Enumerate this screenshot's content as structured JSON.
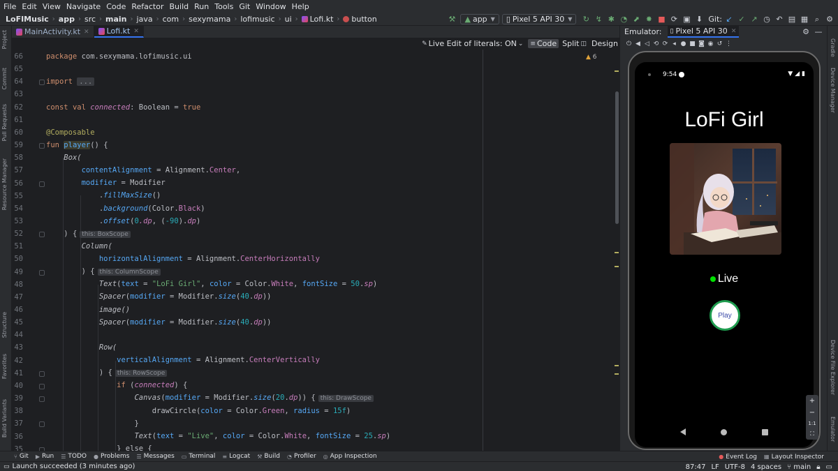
{
  "menu": [
    "File",
    "Edit",
    "View",
    "Navigate",
    "Code",
    "Refactor",
    "Build",
    "Run",
    "Tools",
    "Git",
    "Window",
    "Help"
  ],
  "breadcrumbs": [
    "LoFIMusic",
    "app",
    "src",
    "main",
    "java",
    "com",
    "sexymama",
    "lofimusic",
    "ui",
    "Lofi.kt",
    "button"
  ],
  "run_config": "app",
  "device": "Pixel 5 API 30",
  "git_label": "Git:",
  "tabs": [
    {
      "label": "MainActivity.kt",
      "active": false
    },
    {
      "label": "Lofi.kt",
      "active": true
    }
  ],
  "editor_toolbar": {
    "live_edit": "Live Edit of literals: ON",
    "code": "Code",
    "split": "Split",
    "design": "Design"
  },
  "warnings_count": "6",
  "code": {
    "line_numbers": [
      "66",
      "65",
      "64",
      "63",
      "62",
      "61",
      "60",
      "59",
      "58",
      "57",
      "56",
      "55",
      "54",
      "53",
      "52",
      "51",
      "50",
      "49",
      "48",
      "47",
      "46",
      "45",
      "44",
      "43",
      "42",
      "41",
      "40",
      "39",
      "38",
      "37",
      "36",
      "35"
    ],
    "l66": {
      "kw": "package",
      "rest": "com.sexymama.lofimusic.ui"
    },
    "l64": {
      "kw": "import",
      "fold": "..."
    },
    "l62": {
      "kw1": "const",
      "kw2": "val",
      "prop": "connected",
      "type": ": Boolean =",
      "val": "true"
    },
    "l60": {
      "ann": "@Composable"
    },
    "l59": {
      "kw": "fun",
      "name": "player",
      "rest": "() {"
    },
    "l58": {
      "text": "Box("
    },
    "l57": {
      "prop": "contentAlignment",
      "eq": "= Alignment.",
      "val": "Center",
      "end": ","
    },
    "l56": {
      "prop": "modifier",
      "rest": "= Modifier"
    },
    "l55": {
      "dot": ".",
      "fn": "fillMaxSize",
      "rest": "()"
    },
    "l54": {
      "dot": ".",
      "fn": "background",
      "open": "(Color.",
      "val": "Black",
      "close": ")"
    },
    "l53": {
      "dot": ".",
      "fn": "offset",
      "open": "(",
      "n1": "0",
      "u1": ".dp",
      "mid": ", (",
      "n2": "-90",
      "close1": ").",
      "u2": "dp",
      "close2": ")"
    },
    "l52": {
      "text": ") {",
      "hint": "this: BoxScope"
    },
    "l51": {
      "text": "Column("
    },
    "l50": {
      "prop": "horizontalAlignment",
      "eq": "= Alignment.",
      "val": "CenterHorizontally"
    },
    "l49": {
      "text": ") {",
      "hint": "this: ColumnScope"
    },
    "l48": {
      "fn": "Text",
      "p1": "text",
      "s1": "\"LoFi Girl\"",
      "p2": "color",
      "c": "Color.",
      "v": "White",
      "p3": "fontSize",
      "n": "50",
      "u": "sp"
    },
    "l47": {
      "fn": "Spacer",
      "p": "modifier",
      "m": "Modifier.",
      "f": "size",
      "n": "40",
      "u": "dp"
    },
    "l46": {
      "text": "image()"
    },
    "l45": {
      "fn": "Spacer",
      "p": "modifier",
      "m": "Modifier.",
      "f": "size",
      "n": "40",
      "u": "dp"
    },
    "l43": {
      "text": "Row("
    },
    "l42": {
      "prop": "verticalAlignment",
      "eq": "= Alignment.",
      "val": "CenterVertically"
    },
    "l41": {
      "text": ") {",
      "hint": "this: RowScope"
    },
    "l40": {
      "kw": "if",
      "prop": "connected",
      "rest": ") {"
    },
    "l39": {
      "fn": "Canvas",
      "p": "modifier",
      "m": "Modifier.",
      "f": "size",
      "n": "20",
      "u": "dp",
      "rest": ")) {",
      "hint": "this: DrawScope"
    },
    "l38": {
      "fn": "drawCircle",
      "p1": "color",
      "c": "Color.",
      "v": "Green",
      "p2": "radius",
      "n": "15f"
    },
    "l37": {
      "text": "}"
    },
    "l36": {
      "fn": "Text",
      "p1": "text",
      "s1": "\"Live\"",
      "p2": "color",
      "c": "Color.",
      "v": "White",
      "p3": "fontSize",
      "n": "25",
      "u": "sp"
    },
    "l35": {
      "text": "} else {"
    }
  },
  "emulator": {
    "title": "Emulator:",
    "tab": "Pixel 5 API 30",
    "status_time": "9:54",
    "app_title": "LoFi Girl",
    "live_label": "Live",
    "play_label": "Play",
    "zoom_in": "+",
    "zoom_out": "−",
    "zoom_reset": "1:1"
  },
  "left_strip": [
    "Project",
    "Commit",
    "Pull Requests",
    "Resource Manager",
    "Structure",
    "Favorites",
    "Build Variants"
  ],
  "right_strip": [
    "Gradle",
    "Device Manager",
    "Device File Explorer",
    "Emulator"
  ],
  "tool_windows": [
    "Git",
    "Run",
    "TODO",
    "Problems",
    "Messages",
    "Terminal",
    "Logcat",
    "Build",
    "Profiler",
    "App Inspection"
  ],
  "tool_windows_right": [
    "Event Log",
    "Layout Inspector"
  ],
  "status": {
    "message": "Launch succeeded (3 minutes ago)",
    "position": "87:47",
    "line_sep": "LF",
    "encoding": "UTF-8",
    "indent": "4 spaces",
    "branch": "main"
  },
  "colors": {
    "accent": "#3574f0",
    "keyword": "#cf8e6d",
    "function": "#56a8f5",
    "annotation": "#b3ae60",
    "property": "#c77dbb",
    "string": "#6aab73",
    "number": "#2aacb8",
    "live_green": "#00e000",
    "play_ring": "#1f9c4f"
  }
}
